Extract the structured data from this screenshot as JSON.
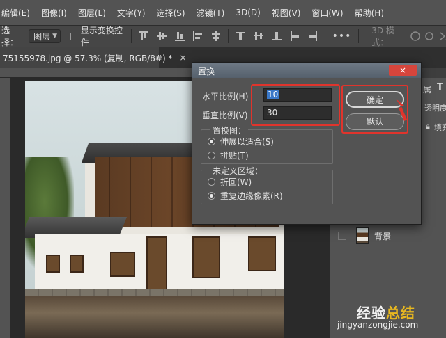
{
  "menu": {
    "items": [
      "编辑(E)",
      "图像(I)",
      "图层(L)",
      "文字(Y)",
      "选择(S)",
      "滤镜(T)",
      "3D(D)",
      "视图(V)",
      "窗口(W)",
      "帮助(H)"
    ]
  },
  "options": {
    "select_label": "选择：",
    "select_value": "图层",
    "show_transform_label": "显示变换控件",
    "mode_label": "3D 模式：",
    "more": "•••"
  },
  "document_tab": {
    "title": "75155978.jpg @ 57.3% (复制, RGB/8#) *",
    "close": "×"
  },
  "right_panel": {
    "properties_fragment": "属",
    "opacity_fragment": "透明度",
    "fill_fragment": "填充",
    "layer_name": "背景"
  },
  "dialog": {
    "title": "置换",
    "close": "×",
    "horizontal_label": "水平比例(H)",
    "horizontal_value": "10",
    "vertical_label": "垂直比例(V)",
    "vertical_value": "30",
    "ok_label": "确定",
    "default_label": "默认",
    "map_group_title": "置换图：",
    "map_options": [
      "伸展以适合(S)",
      "拼贴(T)"
    ],
    "map_selected": 0,
    "undefined_group_title": "未定义区域：",
    "undefined_options": [
      "折回(W)",
      "重复边缘像素(R)"
    ],
    "undefined_selected": 1
  },
  "watermark": {
    "line1_a": "经验",
    "line1_b": "总结",
    "line2": "jingyanzongjie.com"
  },
  "colors": {
    "highlight_red": "#e0342c",
    "selection_blue": "#3a78c9",
    "watermark_gold": "#e8b820"
  }
}
